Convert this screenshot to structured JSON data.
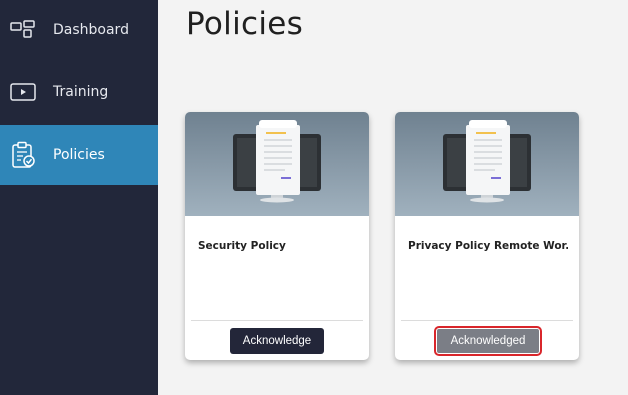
{
  "sidebar": {
    "items": [
      {
        "label": "Dashboard",
        "icon": "dashboard-icon"
      },
      {
        "label": "Training",
        "icon": "training-video-icon"
      },
      {
        "label": "Policies",
        "icon": "clipboard-check-icon",
        "active": true
      }
    ]
  },
  "main": {
    "title": "Policies",
    "cards": [
      {
        "title": "Security Policy",
        "button_label": "Acknowledge",
        "icon": "policy-document-monitor-icon"
      },
      {
        "title": "Privacy Policy Remote Wor...",
        "button_label": "Acknowledged",
        "icon": "policy-document-monitor-icon"
      }
    ]
  },
  "colors": {
    "sidebar_bg": "#22273a",
    "active_item": "#2f86b8",
    "button_dark": "#232639",
    "button_done": "#7b7e86",
    "highlight": "#d9262b"
  }
}
